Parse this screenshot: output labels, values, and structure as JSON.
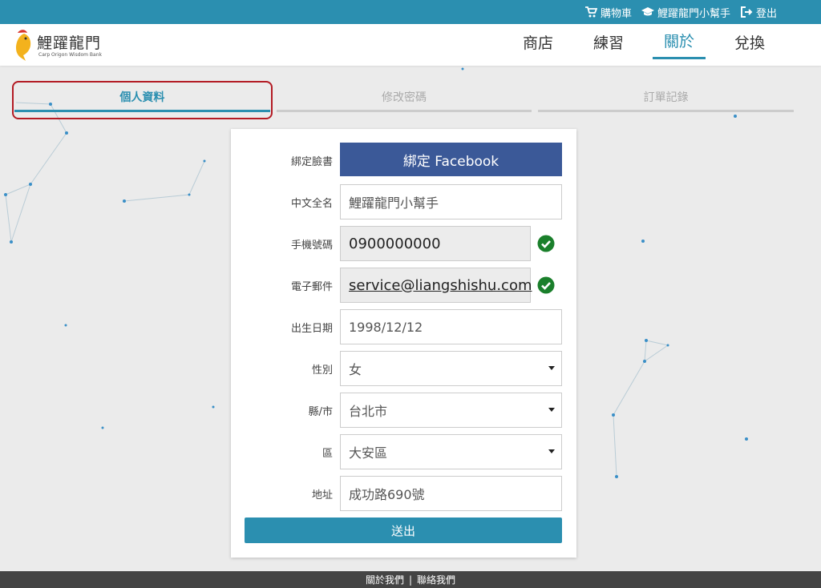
{
  "topbar": {
    "cart_label": "購物車",
    "user_label": "鯉躍龍門小幫手",
    "logout_label": "登出"
  },
  "header": {
    "brand": "鯉躍龍門",
    "tagline": "Carp Origon Wisdom Bank",
    "nav": [
      "商店",
      "練習",
      "關於",
      "兌換"
    ],
    "active_nav": "關於"
  },
  "tabs": [
    "個人資料",
    "修改密碼",
    "訂單記錄"
  ],
  "active_tab": "個人資料",
  "form": {
    "facebook_label": "綁定臉書",
    "facebook_button": "綁定 Facebook",
    "name_label": "中文全名",
    "name_value": "鯉躍龍門小幫手",
    "phone_label": "手機號碼",
    "phone_value": "0900000000",
    "email_label": "電子郵件",
    "email_value": "service@liangshishu.com",
    "birthday_label": "出生日期",
    "birthday_value": "1998/12/12",
    "gender_label": "性別",
    "gender_value": "女",
    "county_label": "縣/市",
    "county_value": "台北市",
    "district_label": "區",
    "district_value": "大安區",
    "address_label": "地址",
    "address_value": "成功路690號",
    "submit_label": "送出"
  },
  "footer": {
    "about": "關於我們",
    "separator": "|",
    "contact": "聯絡我們"
  },
  "colors": {
    "accent": "#2b8fb0",
    "facebook": "#3b5998",
    "verified": "#1a7f2b",
    "highlight": "#b31b24"
  }
}
